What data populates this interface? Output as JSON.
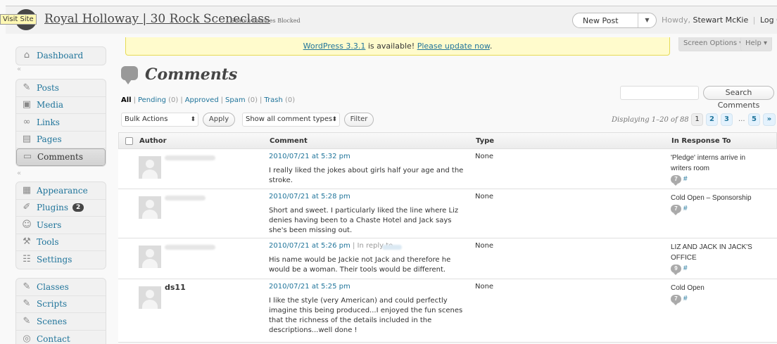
{
  "header": {
    "site_title": "Royal Holloway | 30 Rock Sceneclass",
    "search_engines_blocked": "Search Engines Blocked",
    "visit_site": "Visit Site",
    "new_post": "New Post",
    "howdy": "Howdy,",
    "user_name": "Stewart McKie",
    "log_out": "Log Out"
  },
  "sidebar": {
    "top": [
      {
        "label": "Dashboard",
        "icon": "home-icon"
      }
    ],
    "group1": [
      {
        "label": "Posts",
        "icon": "pin-icon"
      },
      {
        "label": "Media",
        "icon": "media-icon"
      },
      {
        "label": "Links",
        "icon": "link-icon"
      },
      {
        "label": "Pages",
        "icon": "pages-icon"
      },
      {
        "label": "Comments",
        "icon": "comment-icon"
      }
    ],
    "group2": [
      {
        "label": "Appearance",
        "icon": "appearance-icon"
      },
      {
        "label": "Plugins",
        "icon": "plugin-icon",
        "badge": "2"
      },
      {
        "label": "Users",
        "icon": "users-icon"
      },
      {
        "label": "Tools",
        "icon": "tools-icon"
      },
      {
        "label": "Settings",
        "icon": "settings-icon"
      }
    ],
    "group3": [
      {
        "label": "Classes",
        "icon": "pin-icon"
      },
      {
        "label": "Scripts",
        "icon": "pin-icon"
      },
      {
        "label": "Scenes",
        "icon": "pin-icon"
      },
      {
        "label": "Contact",
        "icon": "contact-icon"
      }
    ]
  },
  "notice": {
    "version_link": "WordPress 3.3.1",
    "middle": " is available! ",
    "update_link": "Please update now",
    "end": "."
  },
  "screen_options": "Screen Options ▾",
  "help": "Help ▾",
  "page_title": "Comments",
  "filters": {
    "all": "All",
    "pending": "Pending",
    "pending_count": "(0)",
    "approved": "Approved",
    "spam": "Spam",
    "spam_count": "(0)",
    "trash": "Trash",
    "trash_count": "(0)",
    "sep": "|"
  },
  "search_button": "Search Comments",
  "bulk_actions": "Bulk Actions",
  "apply": "Apply",
  "comment_types": "Show all comment types",
  "filter_button": "Filter",
  "displaying": "Displaying 1–20 of 88",
  "pagination": [
    "1",
    "2",
    "3",
    "...",
    "5",
    "»"
  ],
  "table": {
    "headers": {
      "author": "Author",
      "comment": "Comment",
      "type": "Type",
      "response": "In Response To"
    },
    "rows": [
      {
        "author": "",
        "date": "2010/07/21 at 5:32 pm",
        "reply": "",
        "text": "I really liked the jokes about girls half your age and the stroke.",
        "type": "None",
        "post": "'Pledge' interns arrive in writers room",
        "count": "7",
        "hash": "#"
      },
      {
        "author": "",
        "date": "2010/07/21 at 5:28 pm",
        "reply": "",
        "text": "Short and sweet. I particularly liked the line where Liz denies having been to a Chaste Hotel and Jack says she's been missing out.",
        "type": "None",
        "post": "Cold Open – Sponsorship",
        "count": "7",
        "hash": "#"
      },
      {
        "author": "",
        "date": "2010/07/21 at 5:26 pm",
        "reply": " | In reply to",
        "text": "His name would be Jackie not Jack and therefore he would be a woman. Their tools would be different.",
        "type": "None",
        "post": "LIZ AND JACK IN JACK'S OFFICE",
        "count": "9",
        "hash": "#"
      },
      {
        "author": "ds11",
        "date": "2010/07/21 at 5:25 pm",
        "reply": "",
        "text": "I like the style (very American) and could perfectly imagine this being produced...I enjoyed the fun scenes that the richness of the details included in the descriptions...well done !",
        "type": "None",
        "post": "Cold Open",
        "count": "7",
        "hash": "#"
      }
    ]
  }
}
